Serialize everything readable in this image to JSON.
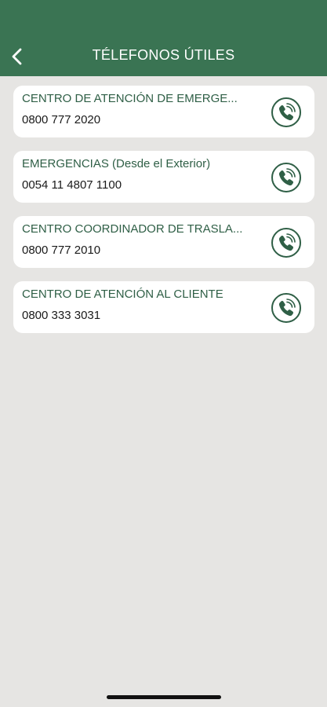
{
  "header": {
    "title": "TÉLEFONOS ÚTILES",
    "back_icon": "chevron-left-icon",
    "background": "#3a7453"
  },
  "contacts": [
    {
      "name": "CENTRO DE ATENCIÓN DE EMERGE...",
      "phone": "0800 777 2020"
    },
    {
      "name": "EMERGENCIAS (Desde el Exterior)",
      "phone": "0054 11 4807 1100"
    },
    {
      "name": "CENTRO COORDINADOR DE TRASLA...",
      "phone": "0800 777 2010"
    },
    {
      "name": "CENTRO DE ATENCIÓN AL CLIENTE",
      "phone": "0800 333 3031"
    }
  ],
  "call_icon": "phone-call-icon",
  "colors": {
    "accent": "#3a7453",
    "label": "#2f5f46",
    "background": "#e6e5e3",
    "card": "#ffffff"
  }
}
